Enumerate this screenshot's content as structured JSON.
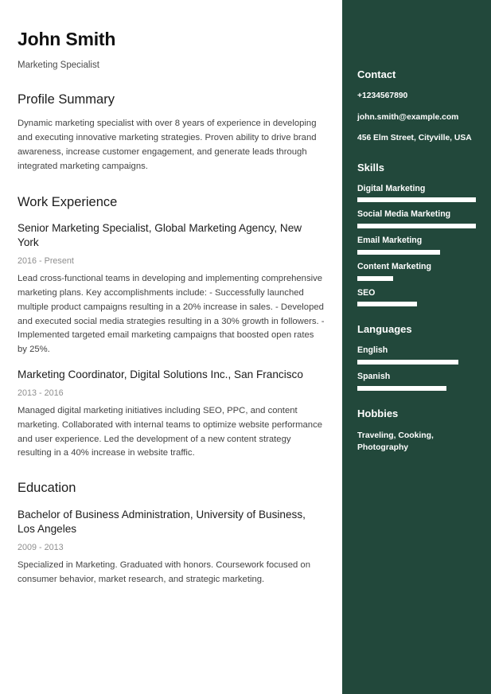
{
  "theme": {
    "sidebar_bg": "#22483b",
    "page_bg": "#ffffff",
    "heading_color": "#1c1c1c",
    "body_color": "#434343",
    "muted_color": "#8e8e8e",
    "bar_color": "#ffffff"
  },
  "header": {
    "name": "John Smith",
    "headline": "Marketing Specialist"
  },
  "profile": {
    "title": "Profile Summary",
    "text": "Dynamic marketing specialist with over 8 years of experience in developing and executing innovative marketing strategies. Proven ability to drive brand awareness, increase customer engagement, and generate leads through integrated marketing campaigns."
  },
  "work": {
    "title": "Work Experience",
    "entries": [
      {
        "title": "Senior Marketing Specialist, Global Marketing Agency, New York",
        "date": "2016 - Present",
        "description": "Lead cross-functional teams in developing and implementing comprehensive marketing plans. Key accomplishments include: - Successfully launched multiple product campaigns resulting in a 20% increase in sales. - Developed and executed social media strategies resulting in a 30% growth in followers. - Implemented targeted email marketing campaigns that boosted open rates by 25%."
      },
      {
        "title": "Marketing Coordinator, Digital Solutions Inc., San Francisco",
        "date": "2013 - 2016",
        "description": "Managed digital marketing initiatives including SEO, PPC, and content marketing. Collaborated with internal teams to optimize website performance and user experience. Led the development of a new content strategy resulting in a 40% increase in website traffic."
      }
    ]
  },
  "education": {
    "title": "Education",
    "entries": [
      {
        "title": "Bachelor of Business Administration, University of Business, Los Angeles",
        "date": "2009 - 2013",
        "description": "Specialized in Marketing. Graduated with honors. Coursework focused on consumer behavior, market research, and strategic marketing."
      }
    ]
  },
  "sidebar": {
    "contact": {
      "title": "Contact",
      "phone": "+1234567890",
      "email": "john.smith@example.com",
      "address": "456 Elm Street, Cityville, USA"
    },
    "skills": {
      "title": "Skills",
      "items": [
        {
          "label": "Digital Marketing",
          "level": 100
        },
        {
          "label": "Social Media Marketing",
          "level": 100
        },
        {
          "label": "Email Marketing",
          "level": 70
        },
        {
          "label": "Content Marketing",
          "level": 30
        },
        {
          "label": "SEO",
          "level": 50
        }
      ]
    },
    "languages": {
      "title": "Languages",
      "items": [
        {
          "label": "English",
          "level": 85
        },
        {
          "label": "Spanish",
          "level": 75
        }
      ]
    },
    "hobbies": {
      "title": "Hobbies",
      "text": "Traveling, Cooking, Photography"
    }
  }
}
